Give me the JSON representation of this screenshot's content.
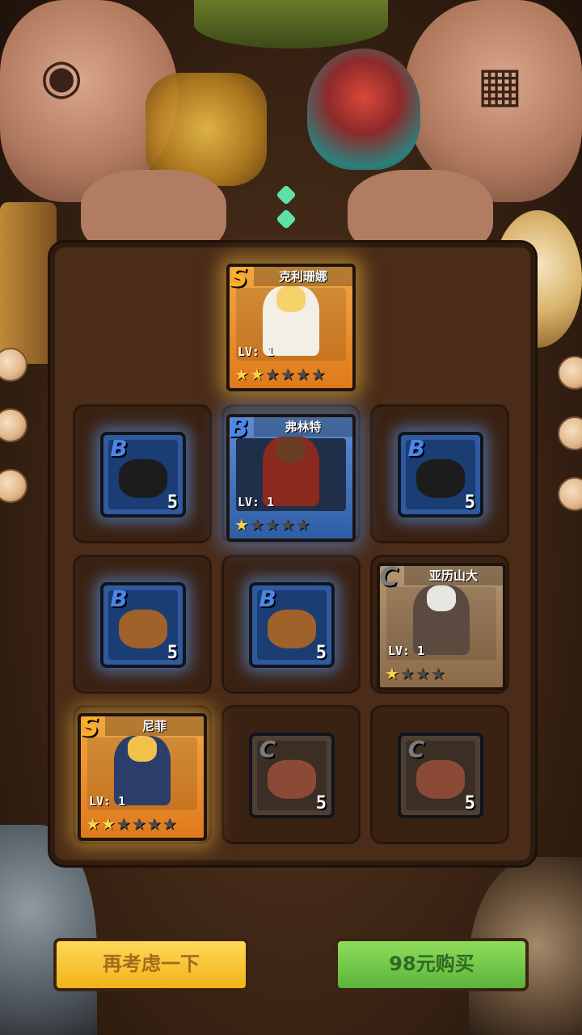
{
  "heroes": [
    {
      "name": "克利珊娜",
      "rank": "S",
      "level": "LV: 1",
      "stars_filled": 2,
      "stars_total": 6
    },
    {
      "name": "弗林特",
      "rank": "B",
      "level": "LV: 1",
      "stars_filled": 1,
      "stars_total": 5
    },
    {
      "name": "亚历山大",
      "rank": "C",
      "level": "LV: 1",
      "stars_filled": 1,
      "stars_total": 4
    },
    {
      "name": "尼菲",
      "rank": "S",
      "level": "LV: 1",
      "stars_filled": 2,
      "stars_total": 6
    }
  ],
  "fragments": [
    {
      "rank": "B",
      "count": "5",
      "creature": "dark-beast"
    },
    {
      "rank": "B",
      "count": "5",
      "creature": "dark-beast"
    },
    {
      "rank": "B",
      "count": "5",
      "creature": "brown-beast"
    },
    {
      "rank": "B",
      "count": "5",
      "creature": "brown-beast"
    },
    {
      "rank": "C",
      "count": "5",
      "creature": "villager"
    },
    {
      "rank": "C",
      "count": "5",
      "creature": "villager"
    }
  ],
  "buttons": {
    "reconsider": "再考虑一下",
    "buy": "98元购买"
  },
  "colors": {
    "rank_S": "#e98a24",
    "rank_B": "#3d6db8",
    "rank_C": "#a07f5b",
    "star_on": "#ffd34a",
    "star_off": "#4a4a4a",
    "button_yellow": "#f5c232",
    "button_green": "#6cc444"
  }
}
